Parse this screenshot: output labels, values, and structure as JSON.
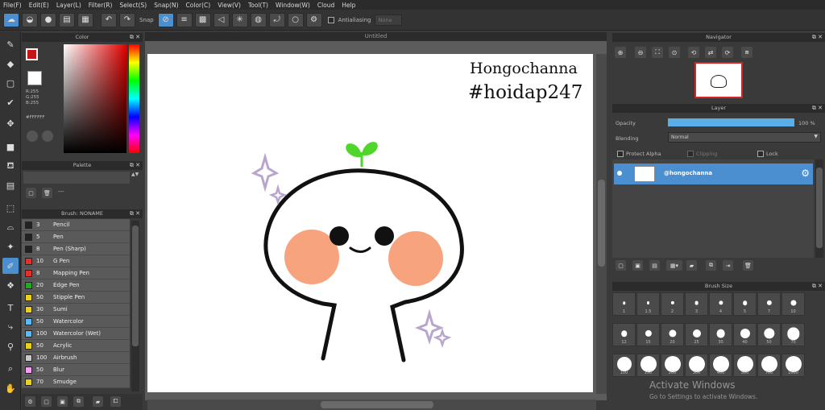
{
  "menu": [
    "File(F)",
    "Edit(E)",
    "Layer(L)",
    "Filter(R)",
    "Select(S)",
    "Snap(N)",
    "Color(C)",
    "View(V)",
    "Tool(T)",
    "Window(W)",
    "Cloud",
    "Help"
  ],
  "toolbar": {
    "snap_label": "Snap",
    "antialias_label": "Antialiasing",
    "smooth_placeholder": "None"
  },
  "color_panel": {
    "title": "Color",
    "rgb": [
      "R:255",
      "G:255",
      "B:255"
    ],
    "hex": "#FFFFFF"
  },
  "palette_panel": {
    "title": "Palette",
    "field": "---"
  },
  "brush_panel": {
    "title": "Brush: NONAME",
    "items": [
      {
        "size": "3",
        "name": "Pencil",
        "color": "#222222"
      },
      {
        "size": "5",
        "name": "Pen",
        "color": "#222222"
      },
      {
        "size": "8",
        "name": "Pen (Sharp)",
        "color": "#222222"
      },
      {
        "size": "10",
        "name": "G Pen",
        "color": "#e03030"
      },
      {
        "size": "8",
        "name": "Mapping Pen",
        "color": "#e03030"
      },
      {
        "size": "20",
        "name": "Edge Pen",
        "color": "#22aa22"
      },
      {
        "size": "50",
        "name": "Stipple Pen",
        "color": "#e8d020"
      },
      {
        "size": "30",
        "name": "Sumi",
        "color": "#e8d020"
      },
      {
        "size": "50",
        "name": "Watercolor",
        "color": "#60b8f0"
      },
      {
        "size": "100",
        "name": "Watercolor (Wet)",
        "color": "#60b8f0"
      },
      {
        "size": "50",
        "name": "Acrylic",
        "color": "#e8d020"
      },
      {
        "size": "100",
        "name": "Airbrush",
        "color": "#c8c8c8"
      },
      {
        "size": "50",
        "name": "Blur",
        "color": "#f0a0f0"
      },
      {
        "size": "70",
        "name": "Smudge",
        "color": "#e8d020"
      }
    ]
  },
  "canvas": {
    "tab_title": "Untitled",
    "caption_line1": "Hongochanna",
    "caption_line2": "#hoidap247"
  },
  "navigator": {
    "title": "Navigator"
  },
  "layer_panel": {
    "title": "Layer",
    "opacity_label": "Opacity",
    "opacity_value": "100 %",
    "opacity_fraction": 1.0,
    "blending_label": "Blending",
    "blending_value": "Normal",
    "protect_alpha": "Protect Alpha",
    "clipping": "Clipping",
    "lock": "Lock",
    "layer_name": "@hongochanna"
  },
  "brush_size_panel": {
    "title": "Brush Size",
    "sizes": [
      "1",
      "1.5",
      "2",
      "3",
      "4",
      "5",
      "7",
      "10",
      "12",
      "15",
      "20",
      "25",
      "30",
      "40",
      "50",
      "70",
      "100",
      "150",
      "200",
      "300",
      "400",
      "500",
      "700",
      "1000"
    ]
  },
  "watermark": {
    "line1": "Activate Windows",
    "line2": "Go to Settings to activate Windows."
  }
}
